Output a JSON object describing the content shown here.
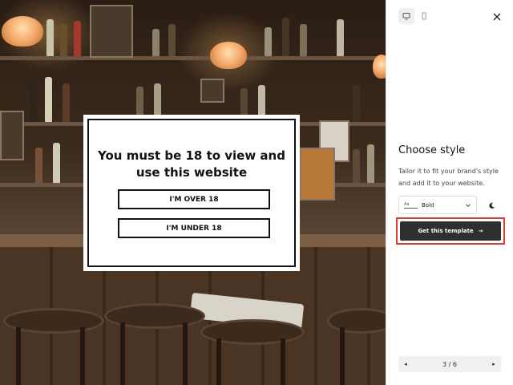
{
  "age_gate": {
    "title": "You must be 18 to view and use this website",
    "over_label": "I'M OVER 18",
    "under_label": "I'M UNDER 18"
  },
  "panel": {
    "device_toggle": {
      "desktop_icon": "monitor-icon",
      "mobile_icon": "phone-icon",
      "active": "desktop"
    },
    "close_icon": "close-icon",
    "title": "Choose style",
    "description": "Tailor it to fit your brand's style and add it to your website.",
    "font_select": {
      "icon_text": "Aa",
      "value": "Bold"
    },
    "theme_icon": "moon-icon",
    "cta_label": "Get this template",
    "cta_arrow": "→",
    "pager": {
      "label": "3 / 6",
      "prev": "◂",
      "next": "▸"
    }
  },
  "colors": {
    "cta_bg": "#2d2f30",
    "highlight": "#e03c31"
  }
}
